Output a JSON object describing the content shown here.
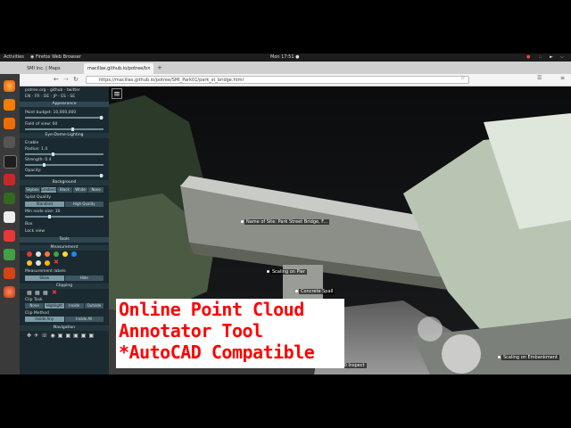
{
  "os_bar": {
    "activities": "Activities",
    "app_name": "Firefox Web Browser",
    "clock": "Mon 17:51 ●"
  },
  "browser": {
    "tabs": [
      {
        "label": "SMI Inc. | Maps"
      },
      {
        "label": "macillas.github.io/potree/b"
      }
    ],
    "url": "https://macillas.github.io/potree/SMI_Park01/park_st_bridge.html"
  },
  "sidebar": {
    "brand": "potree.org - github - twitter",
    "languages": "EN - FR - DE - JP - ES - SE",
    "sections": {
      "appearance": "Appearance",
      "eye_dome": "Eye-Dome-Lighting",
      "background": "Background",
      "other": "Other",
      "tools": "Tools",
      "measurement": "Measurement",
      "clipping": "Clipping",
      "navigation": "Navigation"
    },
    "point_budget": "Point budget: 10,000,000",
    "field_of_view": "Field of view: 60",
    "edl_enable": "Enable",
    "radius": "Radius: 1.4",
    "strength": "Strength: 0.4",
    "opacity": "Opacity:",
    "background_options": [
      "Skybox",
      "Gradient",
      "Black",
      "White",
      "None"
    ],
    "background_selected": "Gradient",
    "splat_quality": "Splat Quality",
    "splat_options": [
      "Standard",
      "High Quality"
    ],
    "min_node_size": "Min node size: 30",
    "box": "Box",
    "lock_view": "Lock view",
    "measurement_labels": "Measurement labels",
    "show_hide": [
      "Show",
      "Hide"
    ],
    "clip_task": "Clip Task",
    "clip_task_options": [
      "None",
      "Highlight",
      "Inside",
      "Outside"
    ],
    "clip_task_selected": "Highlight",
    "clip_method": "Clip Method",
    "clip_method_options": [
      "Inside Any",
      "Inside All"
    ]
  },
  "viewer": {
    "annotations": [
      {
        "text": "Name of Site: Park Street Bridge, F..."
      },
      {
        "text": "Scaling on Pier"
      },
      {
        "text": "Concrete Spall"
      },
      {
        "text": "Scaling on Embankment"
      },
      {
        "text": "Date: 380 Inspect"
      }
    ]
  },
  "caption": {
    "line1": "Online Point Cloud",
    "line2": "Annotator Tool",
    "line3": "*AutoCAD Compatible"
  }
}
